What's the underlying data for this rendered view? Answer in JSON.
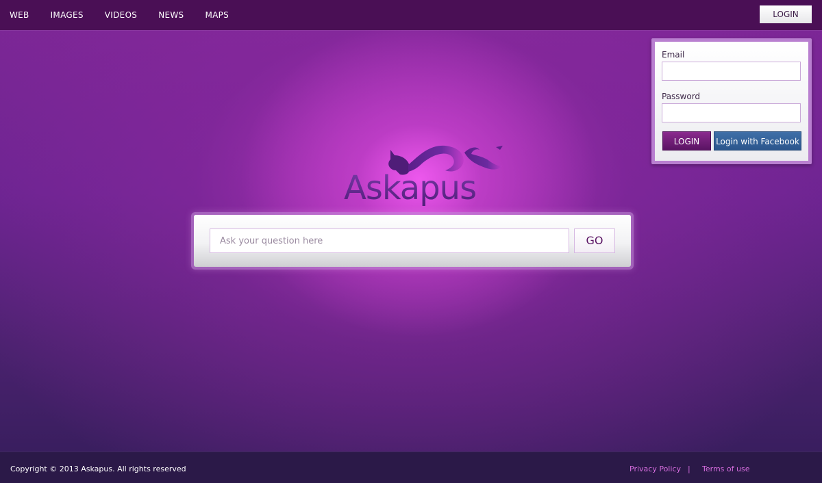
{
  "nav": {
    "items": [
      "WEB",
      "IMAGES",
      "VIDEOS",
      "NEWS",
      "MAPS"
    ],
    "login_label": "LOGIN"
  },
  "login_panel": {
    "email_label": "Email",
    "email_value": "",
    "password_label": "Password",
    "password_value": "",
    "login_button": "LOGIN",
    "facebook_button": "Login with Facebook"
  },
  "logo": {
    "text": "Askapus"
  },
  "search": {
    "placeholder": "Ask your question here",
    "value": "",
    "go_label": "GO"
  },
  "footer": {
    "copyright": "Copyright © 2013 Askapus. All rights reserved",
    "privacy": "Privacy Policy",
    "separator": "|",
    "terms": "Terms of use"
  },
  "colors": {
    "topbar": "#4a0f55",
    "accent": "#8a2a8e",
    "facebook": "#2b568c",
    "footer": "#2b1948",
    "footer_link": "#d86ee0"
  }
}
